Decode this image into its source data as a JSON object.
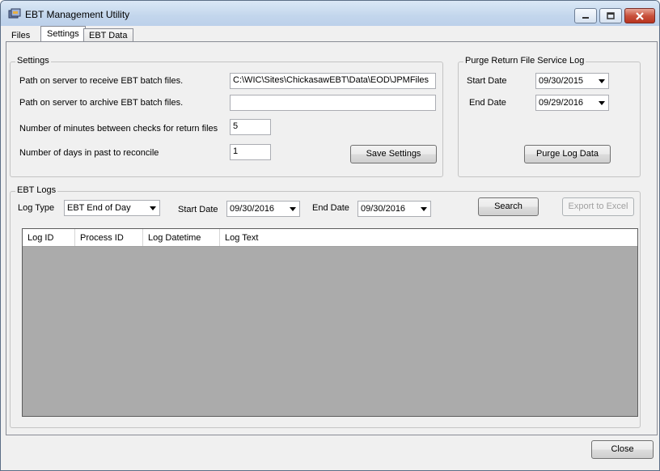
{
  "window": {
    "title": "EBT Management Utility"
  },
  "tabs": [
    {
      "label": "Files"
    },
    {
      "label": "Settings"
    },
    {
      "label": "EBT Data"
    }
  ],
  "settings": {
    "legend": "Settings",
    "receive_path_label": "Path on server to receive EBT batch files.",
    "receive_path_value": "C:\\WIC\\Sites\\ChickasawEBT\\Data\\EOD\\JPMFiles",
    "archive_path_label": "Path on server to archive EBT batch files.",
    "archive_path_value": "",
    "minutes_label": "Number of minutes between checks for return files",
    "minutes_value": "5",
    "days_label": "Number of days in past to reconcile",
    "days_value": "1",
    "save_label": "Save Settings"
  },
  "purge": {
    "legend": "Purge Return File Service Log",
    "start_label": "Start Date",
    "start_value": "09/30/2015",
    "end_label": "End Date",
    "end_value": "09/29/2016",
    "purge_label": "Purge Log Data"
  },
  "logs": {
    "legend": "EBT Logs",
    "log_type_label": "Log Type",
    "log_type_value": "EBT End of Day",
    "start_label": "Start Date",
    "start_value": "09/30/2016",
    "end_label": "End Date",
    "end_value": "09/30/2016",
    "search_label": "Search",
    "export_label": "Export to Excel",
    "columns": [
      "Log ID",
      "Process ID",
      "Log Datetime",
      "Log Text"
    ]
  },
  "footer": {
    "close_label": "Close"
  },
  "colors": {
    "grid_background": "#ababab",
    "close_button": "#c9523e"
  }
}
